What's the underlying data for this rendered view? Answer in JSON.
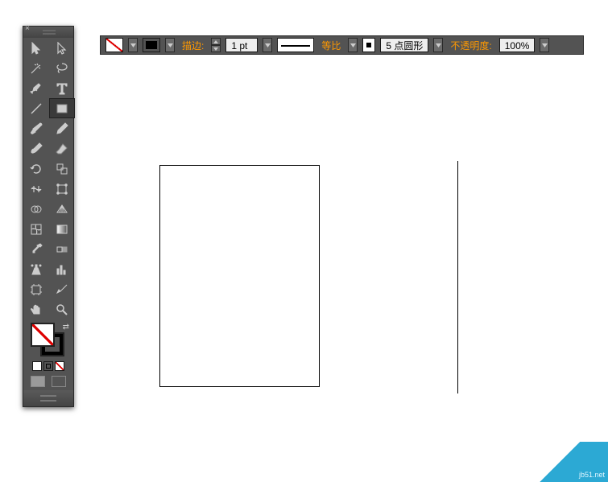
{
  "options_bar": {
    "fill_swatch": "none",
    "stroke_swatch": "black",
    "stroke_label": "描边:",
    "stroke_value": "1 pt",
    "stroke_type_label": "等比",
    "brush_label": "5 点圆形",
    "opacity_label": "不透明度:",
    "opacity_value": "100%"
  },
  "tools": {
    "close_glyph": "×",
    "selected": "rectangle-tool"
  },
  "watermark": "jb51.net"
}
